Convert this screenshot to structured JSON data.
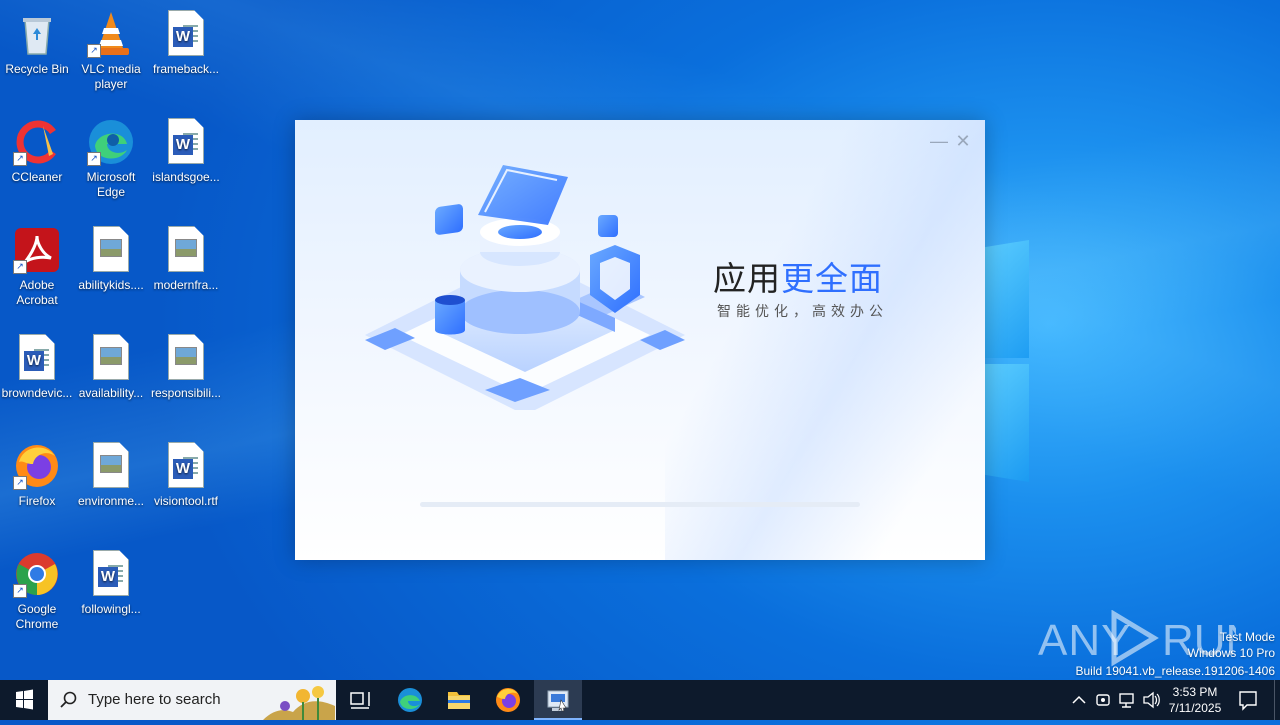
{
  "desktop": {
    "icons": [
      {
        "label": "Recycle Bin"
      },
      {
        "label": "VLC media player"
      },
      {
        "label": "frameback..."
      },
      {
        "label": "CCleaner"
      },
      {
        "label": "Microsoft Edge"
      },
      {
        "label": "islandsgoe..."
      },
      {
        "label": "Adobe Acrobat"
      },
      {
        "label": "abilitykids...."
      },
      {
        "label": "modernfra..."
      },
      {
        "label": "browndevic..."
      },
      {
        "label": "availability..."
      },
      {
        "label": "responsibili..."
      },
      {
        "label": "Firefox"
      },
      {
        "label": "environme..."
      },
      {
        "label": "visiontool.rtf"
      },
      {
        "label": "Google Chrome"
      },
      {
        "label": "followingl..."
      }
    ]
  },
  "installer": {
    "headline_plain": "应用",
    "headline_highlight": "更全面",
    "subline": "智能优化，高效办公",
    "minimize_glyph": "—",
    "close_glyph": "✕",
    "progress_fraction": 0.0
  },
  "taskbar": {
    "search_placeholder": "Type here to search",
    "time": "3:53 PM",
    "date": "7/11/2025"
  },
  "watermark": {
    "brand": "ANY RUN",
    "line1": "Test Mode",
    "line2": "Windows 10 Pro",
    "line3": "Build 19041.vb_release.191206-1406"
  },
  "colors": {
    "accent_blue": "#2f6fff",
    "taskbar_bg": "#0d1a2c"
  }
}
